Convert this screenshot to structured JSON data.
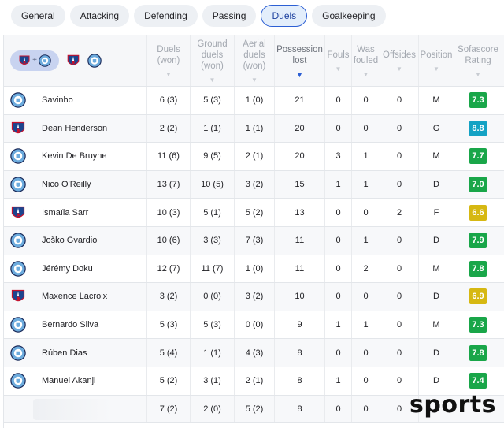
{
  "tabs": [
    {
      "label": "General",
      "active": false
    },
    {
      "label": "Attacking",
      "active": false
    },
    {
      "label": "Defending",
      "active": false
    },
    {
      "label": "Passing",
      "active": false
    },
    {
      "label": "Duels",
      "active": true
    },
    {
      "label": "Goalkeeping",
      "active": false
    }
  ],
  "filter": {
    "combo_sep": "+"
  },
  "columns": [
    {
      "key": "duels",
      "label": "Duels\n(won)",
      "sorted": false
    },
    {
      "key": "ground",
      "label": "Ground\nduels\n(won)",
      "sorted": false
    },
    {
      "key": "aerial",
      "label": "Aerial\nduels\n(won)",
      "sorted": false
    },
    {
      "key": "poss",
      "label": "Possession\nlost",
      "sorted": true
    },
    {
      "key": "fouls",
      "label": "Fouls",
      "sorted": false
    },
    {
      "key": "fouled",
      "label": "Was\nfouled",
      "sorted": false
    },
    {
      "key": "offsides",
      "label": "Offsides",
      "sorted": false
    },
    {
      "key": "pos",
      "label": "Position",
      "sorted": false
    },
    {
      "key": "rating",
      "label": "Sofascore\nRating",
      "sorted": false
    }
  ],
  "arrow": "▼",
  "colors": {
    "rating_green_dark": "#19a649",
    "rating_teal": "#14a2c4",
    "rating_yellow": "#d6b812",
    "rating_green": "#5bb53a",
    "accent": "#2c5fd4"
  },
  "players": [
    {
      "team": "mc",
      "name": "Savinho",
      "duels": "6 (3)",
      "ground": "5 (3)",
      "aerial": "1 (0)",
      "poss": "21",
      "fouls": "0",
      "fouled": "0",
      "offsides": "0",
      "pos": "M",
      "rating": "7.3",
      "rating_color": "#19a649"
    },
    {
      "team": "cp",
      "name": "Dean Henderson",
      "duels": "2 (2)",
      "ground": "1 (1)",
      "aerial": "1 (1)",
      "poss": "20",
      "fouls": "0",
      "fouled": "0",
      "offsides": "0",
      "pos": "G",
      "rating": "8.8",
      "rating_color": "#14a2c4"
    },
    {
      "team": "mc",
      "name": "Kevin De Bruyne",
      "duels": "11 (6)",
      "ground": "9 (5)",
      "aerial": "2 (1)",
      "poss": "20",
      "fouls": "3",
      "fouled": "1",
      "offsides": "0",
      "pos": "M",
      "rating": "7.7",
      "rating_color": "#19a649"
    },
    {
      "team": "mc",
      "name": "Nico O'Reilly",
      "duels": "13 (7)",
      "ground": "10 (5)",
      "aerial": "3 (2)",
      "poss": "15",
      "fouls": "1",
      "fouled": "1",
      "offsides": "0",
      "pos": "D",
      "rating": "7.0",
      "rating_color": "#19a649"
    },
    {
      "team": "cp",
      "name": "Ismaïla Sarr",
      "duels": "10 (3)",
      "ground": "5 (1)",
      "aerial": "5 (2)",
      "poss": "13",
      "fouls": "0",
      "fouled": "0",
      "offsides": "2",
      "pos": "F",
      "rating": "6.6",
      "rating_color": "#d6b812"
    },
    {
      "team": "mc",
      "name": "Joško Gvardiol",
      "duels": "10 (6)",
      "ground": "3 (3)",
      "aerial": "7 (3)",
      "poss": "11",
      "fouls": "0",
      "fouled": "1",
      "offsides": "0",
      "pos": "D",
      "rating": "7.9",
      "rating_color": "#19a649"
    },
    {
      "team": "mc",
      "name": "Jérémy Doku",
      "duels": "12 (7)",
      "ground": "11 (7)",
      "aerial": "1 (0)",
      "poss": "11",
      "fouls": "0",
      "fouled": "2",
      "offsides": "0",
      "pos": "M",
      "rating": "7.8",
      "rating_color": "#19a649"
    },
    {
      "team": "cp",
      "name": "Maxence Lacroix",
      "duels": "3 (2)",
      "ground": "0 (0)",
      "aerial": "3 (2)",
      "poss": "10",
      "fouls": "0",
      "fouled": "0",
      "offsides": "0",
      "pos": "D",
      "rating": "6.9",
      "rating_color": "#d6b812"
    },
    {
      "team": "mc",
      "name": "Bernardo Silva",
      "duels": "5 (3)",
      "ground": "5 (3)",
      "aerial": "0 (0)",
      "poss": "9",
      "fouls": "1",
      "fouled": "1",
      "offsides": "0",
      "pos": "M",
      "rating": "7.3",
      "rating_color": "#19a649"
    },
    {
      "team": "mc",
      "name": "Rúben Dias",
      "duels": "5 (4)",
      "ground": "1 (1)",
      "aerial": "4 (3)",
      "poss": "8",
      "fouls": "0",
      "fouled": "0",
      "offsides": "0",
      "pos": "D",
      "rating": "7.8",
      "rating_color": "#19a649"
    },
    {
      "team": "mc",
      "name": "Manuel Akanji",
      "duels": "5 (2)",
      "ground": "3 (1)",
      "aerial": "2 (1)",
      "poss": "8",
      "fouls": "1",
      "fouled": "0",
      "offsides": "0",
      "pos": "D",
      "rating": "7.4",
      "rating_color": "#19a649"
    }
  ],
  "partial_row": {
    "duels": "7 (2)",
    "ground": "2 (0)",
    "aerial": "5 (2)",
    "poss": "8",
    "fouls": "0",
    "fouled": "0",
    "offsides": "0"
  },
  "watermark": "sports"
}
